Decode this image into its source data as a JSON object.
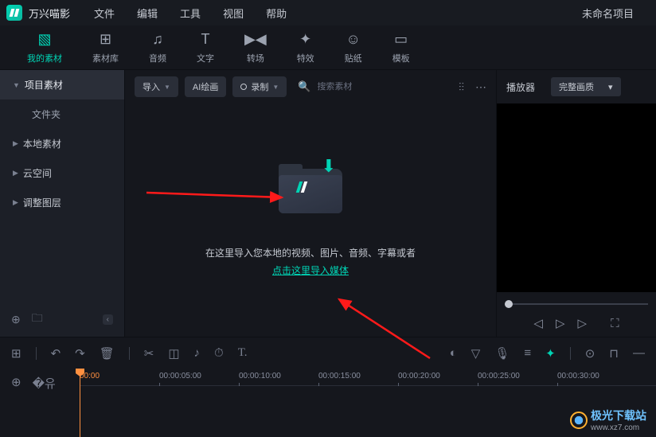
{
  "titlebar": {
    "app_name": "万兴喵影",
    "menu": [
      "文件",
      "编辑",
      "工具",
      "视图",
      "帮助"
    ],
    "project_name": "未命名项目"
  },
  "toolbar": {
    "items": [
      {
        "label": "我的素材",
        "icon": "▧"
      },
      {
        "label": "素材库",
        "icon": "⊞"
      },
      {
        "label": "音频",
        "icon": "♫"
      },
      {
        "label": "文字",
        "icon": "T"
      },
      {
        "label": "转场",
        "icon": "▶◀"
      },
      {
        "label": "特效",
        "icon": "✦"
      },
      {
        "label": "贴纸",
        "icon": "☺"
      },
      {
        "label": "模板",
        "icon": "▭"
      }
    ]
  },
  "sidebar": {
    "items": [
      {
        "label": "项目素材",
        "expanded": true,
        "highlight": true
      },
      {
        "label": "文件夹"
      },
      {
        "label": "本地素材"
      },
      {
        "label": "云空间"
      },
      {
        "label": "调整图层"
      }
    ]
  },
  "content_bar": {
    "import": "导入",
    "ai": "AI绘画",
    "record": "录制",
    "search_placeholder": "搜索素材"
  },
  "drop": {
    "line1": "在这里导入您本地的视频、图片、音频、字幕或者",
    "link": "点击这里导入媒体"
  },
  "player": {
    "tab": "播放器",
    "quality": "完整画质"
  },
  "timeline": {
    "ticks": [
      "00:00",
      "00:00:05:00",
      "00:00:10:00",
      "00:00:15:00",
      "00:00:20:00",
      "00:00:25:00",
      "00:00:30:00"
    ]
  },
  "watermark": {
    "brand": "极光下载站",
    "url": "www.xz7.com"
  }
}
